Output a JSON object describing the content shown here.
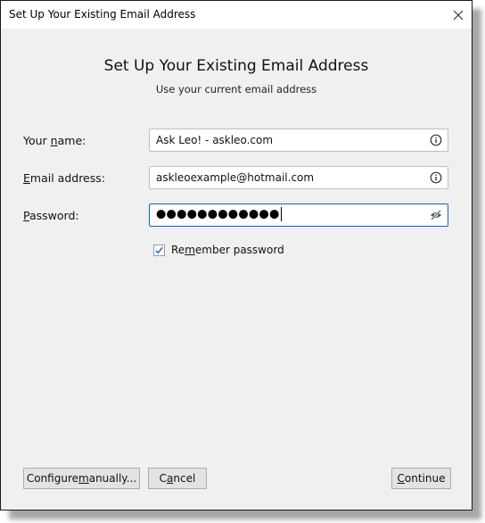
{
  "window": {
    "title": "Set Up Your Existing Email Address",
    "close_icon": "close-icon"
  },
  "header": {
    "title": "Set Up Your Existing Email Address",
    "subtitle": "Use your current email address"
  },
  "form": {
    "name": {
      "label_pre": "Your ",
      "label_accel": "n",
      "label_post": "ame:",
      "value": "Ask Leo! - askleo.com",
      "icon": "info-icon"
    },
    "email": {
      "label_pre": "",
      "label_accel": "E",
      "label_post": "mail address:",
      "value": "askleoexample@hotmail.com",
      "icon": "info-icon"
    },
    "password": {
      "label_pre": "",
      "label_accel": "P",
      "label_post": "assword:",
      "masked_value": "●●●●●●●●●●●●",
      "icon": "eye-slash-icon"
    },
    "remember": {
      "label_pre": "Re",
      "label_accel": "m",
      "label_post": "ember password",
      "checked": true
    }
  },
  "buttons": {
    "configure": {
      "pre": "Configure ",
      "accel": "m",
      "post": "anually..."
    },
    "cancel": {
      "pre": "C",
      "accel": "a",
      "post": "ncel"
    },
    "continue": {
      "pre": "",
      "accel": "C",
      "post": "ontinue"
    }
  },
  "colors": {
    "focus_border": "#0a64c8",
    "check_color": "#0a64c8",
    "dialog_bg": "#f0f0f0"
  }
}
